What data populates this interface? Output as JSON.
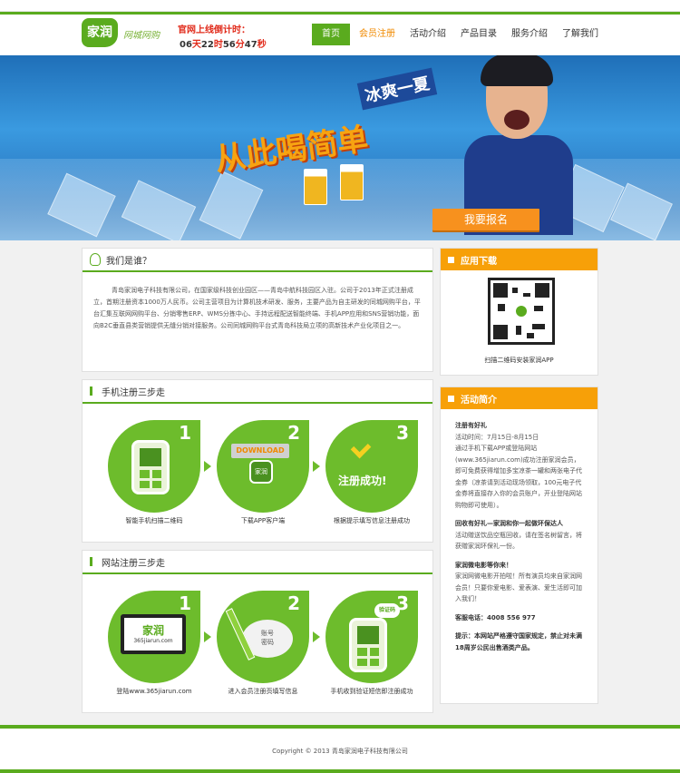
{
  "header": {
    "logo_text": "家润",
    "logo_subtitle": "网城网购",
    "countdown_title": "官网上线倒计时：",
    "countdown": {
      "days": "06",
      "days_unit": "天",
      "hours": "22",
      "hours_unit": "时",
      "minutes": "56",
      "minutes_unit": "分",
      "seconds": "47",
      "seconds_unit": "秒"
    },
    "nav": [
      {
        "label": "首页"
      },
      {
        "label": "会员注册"
      },
      {
        "label": "活动介绍"
      },
      {
        "label": "产品目录"
      },
      {
        "label": "服务介绍"
      },
      {
        "label": "了解我们"
      }
    ],
    "brand_green": "#5aab1e",
    "accent_orange": "#f7911e"
  },
  "banner": {
    "headline": "从此喝简单",
    "tagline": "冰爽一夏",
    "button": "我要报名"
  },
  "about": {
    "title": "我们是谁？",
    "text": "青岛家润电子科技有限公司，在国家级科技创业园区——青岛中航科技园区入驻。公司于2013年正式注册成立，首期注册资本1000万人民币。公司主营项目为计算机技术研发、服务，主要产品为自主研发的同城网购平台，平台汇集互联网网购平台、分销零售ERP、WMS分拣中心、手持远程配送智能终端、手机APP应用和SNS营销功能，面向B2C垂直县类营销提供无缝分销对接服务。公司同城网购平台式青岛科技局立项的高新技术产业化项目之一。"
  },
  "mobile_steps": {
    "title": "手机注册三步走",
    "steps": [
      {
        "num": "1",
        "caption": "智能手机扫描二维码"
      },
      {
        "num": "2",
        "caption": "下载APP客户端",
        "badge": "DOWNLOAD",
        "icon_text": "家润"
      },
      {
        "num": "3",
        "caption": "根据提示填写信息注册成功",
        "badge": "注册成功!"
      }
    ]
  },
  "web_steps": {
    "title": "网站注册三步走",
    "steps": [
      {
        "num": "1",
        "caption": "登陆www.365jiarun.com",
        "screen_text": "家润",
        "screen_sub": "365jiarun.com"
      },
      {
        "num": "2",
        "caption": "进入会员注册页填写信息",
        "form_text_1": "账号",
        "form_text_2": "密码"
      },
      {
        "num": "3",
        "caption": "手机收到验证短信即注册成功",
        "bubble": "验证码"
      }
    ]
  },
  "app_download": {
    "title": "应用下载",
    "qr_label": "家润",
    "caption": "扫描二维码安装家润APP"
  },
  "activity": {
    "title": "活动简介",
    "blocks": [
      {
        "heading": "注册有好礼",
        "lines": [
          "活动时间：7月15日-8月15日",
          "通过手机下载APP或登陆网站(www.365jiarun.com)成功注册家润会员，即可免费获得增加多宝凉茶一罐和两张电子代金券（凉茶请到活动现场领取，100元电子代金券将直接存入你的会员账户，开业登陆网站购物即可使用）。"
        ]
      },
      {
        "heading": "回收有好礼—家润和你一起做环保达人",
        "lines": [
          "活动赠送饮品空瓶回收，请在签名树留言，将获赠家润环保礼一份。"
        ]
      },
      {
        "heading": "家润微电影等你来！",
        "lines": [
          "家润网微电影开拍啦！所有演员均来自家润网会员！只要你爱电影、爱表演、爱生活即可加入我们！"
        ]
      }
    ],
    "phone_label": "客服电话：",
    "phone": "4008 556 977",
    "notice": "提示：本网站严格遵守国家规定，禁止对未满18周岁公民出售酒类产品。"
  },
  "footer": {
    "copyright": "Copyright © 2013 青岛家润电子科技有限公司"
  }
}
